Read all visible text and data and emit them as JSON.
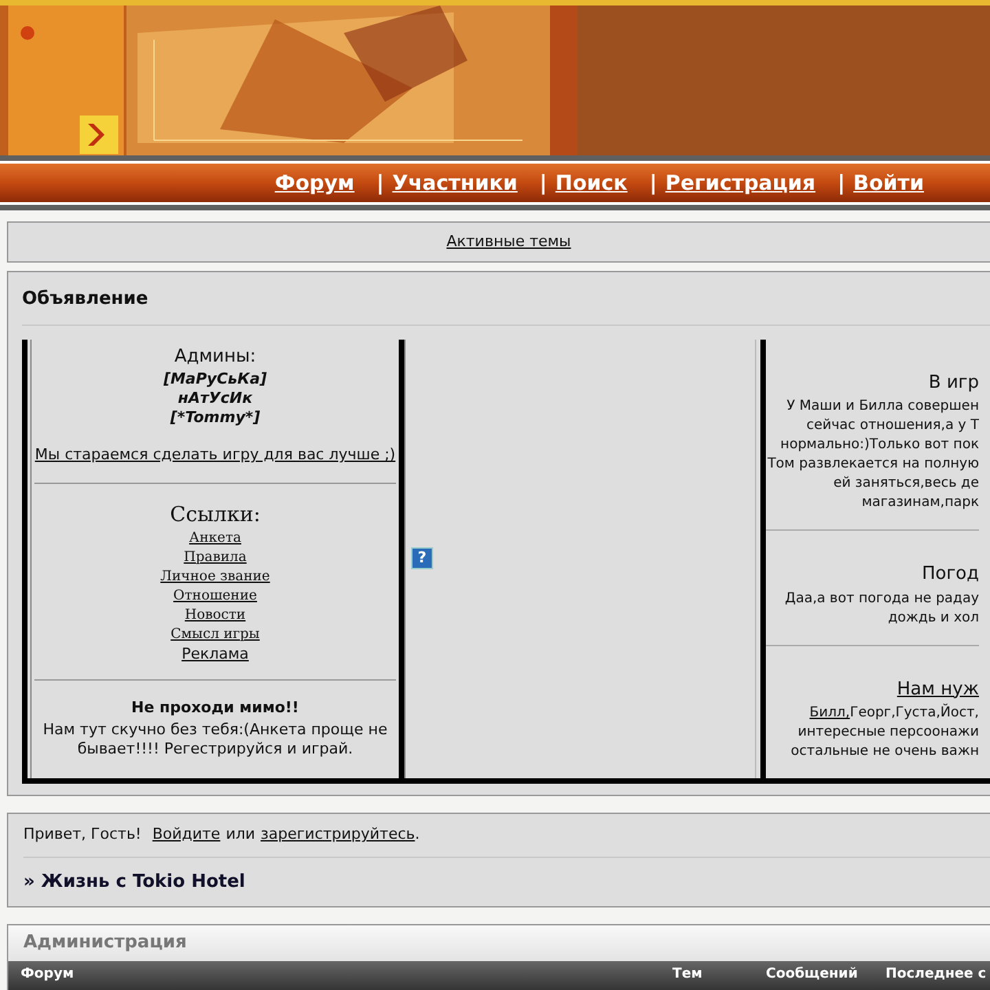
{
  "nav": [
    {
      "kind": "link",
      "label": "Форум"
    },
    {
      "kind": "separator",
      "label": "|"
    },
    {
      "kind": "link",
      "label": "Участники"
    },
    {
      "kind": "separator",
      "label": "|"
    },
    {
      "kind": "link",
      "label": "Поиск"
    },
    {
      "kind": "separator",
      "label": "|"
    },
    {
      "kind": "link",
      "label": "Регистрация"
    },
    {
      "kind": "separator",
      "label": "|"
    },
    {
      "kind": "link",
      "label": "Войти"
    }
  ],
  "active_topics_link": "Активные темы",
  "announcement": {
    "title": "Объявление",
    "left": {
      "admins_heading": "Админы:",
      "admins": [
        "[МаРуСьКа]",
        "нАтУсИк",
        "[*Tommy*]"
      ],
      "tagline": "Мы стараемся сделать игру для вас лучше ;)",
      "links_heading": "Ссылки:",
      "links": [
        {
          "kind": "serif",
          "label": "Анкета"
        },
        {
          "kind": "serif",
          "label": "Правила"
        },
        {
          "kind": "serif",
          "label": "Личное звание"
        },
        {
          "kind": "serif",
          "label": "Отношение"
        },
        {
          "kind": "serif",
          "label": "Новости"
        },
        {
          "kind": "serif",
          "label": "Смысл игры"
        },
        {
          "kind": "sans",
          "label": "Реклама"
        }
      ],
      "promo_title": "Не проходи мимо!!",
      "promo_text": "Нам тут скучно без тебя:(Анкета проще не бывает!!!! Регестрируйся и играй."
    },
    "help_icon": "?",
    "right": [
      {
        "heading": "В игр",
        "underlined": false,
        "lines": [
          [
            {
              "text": "У Маши и Билла совершен",
              "link": false
            }
          ],
          [
            {
              "text": "сейчас отношения,а у Т",
              "link": false
            }
          ],
          [
            {
              "text": "нормально:)Только вот пок",
              "link": false
            }
          ],
          [
            {
              "text": "Том развлекается на полную",
              "link": false
            }
          ],
          [
            {
              "text": "ей заняться,весь де",
              "link": false
            }
          ],
          [
            {
              "text": "магазинам,парк",
              "link": false
            }
          ]
        ]
      },
      {
        "heading": "Погод",
        "underlined": false,
        "lines": [
          [
            {
              "text": "Даа,а вот погода не радау",
              "link": false
            }
          ],
          [
            {
              "text": "дождь и хол",
              "link": false
            }
          ]
        ]
      },
      {
        "heading": "Нам нуж",
        "underlined": true,
        "lines": [
          [
            {
              "text": "Билл,",
              "link": true
            },
            {
              "text": "Георг,Густа,Йост,",
              "link": false
            }
          ],
          [
            {
              "text": "интересные персоонажи",
              "link": false
            }
          ],
          [
            {
              "text": "остальные не очень важн",
              "link": false
            }
          ]
        ]
      }
    ]
  },
  "greeting": [
    {
      "text": "Привет, Гость!",
      "link": false
    },
    {
      "text": "Войдите",
      "link": true
    },
    {
      "text": "или",
      "link": false
    },
    {
      "text": "зарегистрируйтесь",
      "link": true
    },
    {
      "text": ".",
      "link": false
    }
  ],
  "breadcrumb": "» Жизнь с Tokio Hotel",
  "category": {
    "title": "Администрация",
    "columns": [
      "Форум",
      "Тем",
      "Сообщений",
      "Последнее с"
    ]
  }
}
